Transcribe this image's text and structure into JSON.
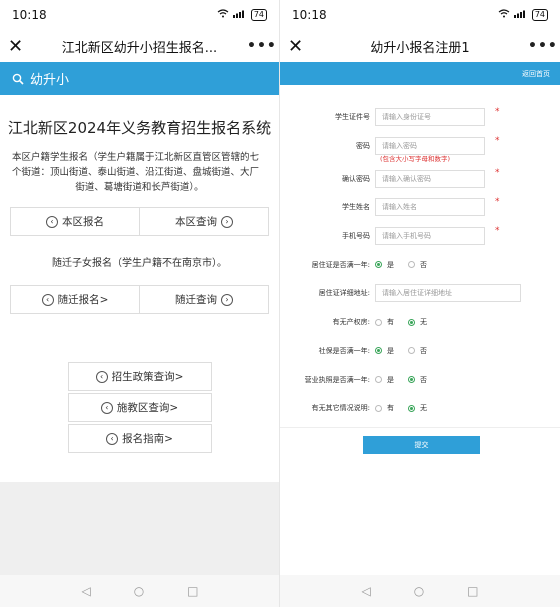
{
  "left": {
    "status": {
      "time": "10:18",
      "battery": "74"
    },
    "nav": {
      "title": "江北新区幼升小招生报名..."
    },
    "search_band": {
      "label": "幼升小"
    },
    "main_title": "江北新区2024年义务教育招生报名系统",
    "desc_line1": "本区户籍学生报名（学生户籍属于江北新区直管区管辖的七个街道：顶山街道、泰山街道、沿江街道、盘城街道、大厂",
    "desc_line2": "街道、葛塘街道和长芦街道）。",
    "row1": {
      "a": "本区报名",
      "b": "本区查询"
    },
    "sub_note": "随迁子女报名（学生户籍不在南京市）。",
    "row2": {
      "a": "随迁报名>",
      "b": "随迁查询"
    },
    "stack": {
      "a": "招生政策查询>",
      "b": "施教区查询>",
      "c": "报名指南>"
    }
  },
  "right": {
    "status": {
      "time": "10:18",
      "battery": "74"
    },
    "nav": {
      "title": "幼升小报名注册1"
    },
    "band": {
      "link": "返回首页"
    },
    "fields": {
      "id_label": "学生证件号",
      "id_ph": "请输入身份证号",
      "pwd_label": "密码",
      "pwd_ph": "请输入密码",
      "pwd_hint": "(包含大小写字母和数字)",
      "cpwd_label": "确认密码",
      "cpwd_ph": "请输入确认密码",
      "name_label": "学生姓名",
      "name_ph": "请输入姓名",
      "phone_label": "手机号码",
      "phone_ph": "请输入手机号码",
      "res_label": "居住证是否满一年:",
      "res_yes": "是",
      "res_no": "否",
      "addr_label": "居住证详细地址:",
      "addr_ph": "请输入居住证详细地址",
      "prop_label": "有无产权房:",
      "prop_yes": "有",
      "prop_no": "无",
      "ss_label": "社保是否满一年:",
      "ss_yes": "是",
      "ss_no": "否",
      "bl_label": "营业执照是否满一年:",
      "bl_yes": "是",
      "bl_no": "否",
      "other_label": "有无其它情况说明:",
      "other_yes": "有",
      "other_no": "无"
    },
    "submit": "提交"
  },
  "icons": [
    "close-icon",
    "more-icon",
    "search-icon",
    "wifi-icon",
    "signal-icon",
    "battery-icon"
  ]
}
